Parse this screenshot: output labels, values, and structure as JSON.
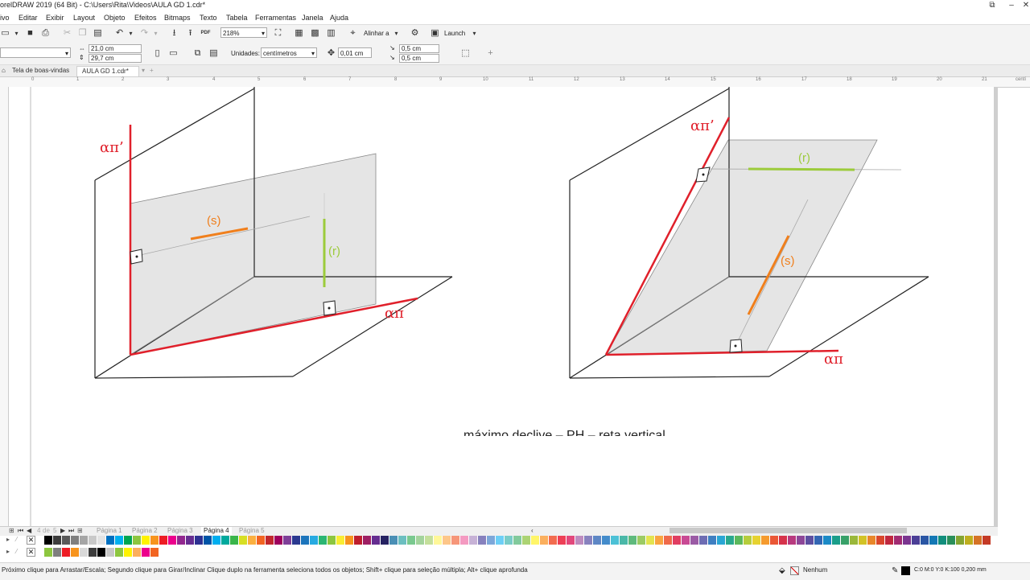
{
  "titlebar": {
    "title": "orelDRAW 2019 (64 Bit) - C:\\Users\\Rita\\Videos\\AULA GD 1.cdr*"
  },
  "menu": [
    "ivo",
    "Editar",
    "Exibir",
    "Layout",
    "Objeto",
    "Efeitos",
    "Bitmaps",
    "Texto",
    "Tabela",
    "Ferramentas",
    "Janela",
    "Ajuda"
  ],
  "toolbar": {
    "zoom": "218%",
    "align_label": "Alinhar a",
    "launch_label": "Launch",
    "pdf_label": "PDF"
  },
  "propbar": {
    "width": "21,0 cm",
    "height": "29,7 cm",
    "units_label": "Unidades:",
    "units_value": "centímetros",
    "nudge": "0,01 cm",
    "dup_x": "0,5 cm",
    "dup_y": "0,5 cm"
  },
  "tabs": {
    "welcome": "Tela de boas-vindas",
    "document": "AULA GD 1.cdr*"
  },
  "ruler": {
    "numbers": [
      "0",
      "1",
      "2",
      "3",
      "4",
      "5",
      "6",
      "7",
      "8",
      "9",
      "10",
      "11",
      "12",
      "13",
      "14",
      "15",
      "16",
      "17",
      "18",
      "19",
      "20",
      "21"
    ],
    "unit": "centí"
  },
  "canvas": {
    "left_figure": {
      "label_vertical_trace": "απ’",
      "label_horizontal_trace": "απ",
      "line_s": "(s)",
      "line_r": "(r)"
    },
    "right_figure": {
      "label_vertical_trace": "απ’",
      "label_horizontal_trace": "απ",
      "line_s": "(s)",
      "line_r": "(r)"
    },
    "caption": "máximo declive – PH – reta vertical"
  },
  "pages": {
    "counter_current": "4",
    "counter_sep": "de",
    "counter_total": "5",
    "tabs": [
      "Página 1",
      "Página 2",
      "Página 3",
      "Página 4",
      "Página 5"
    ],
    "active_index": 3
  },
  "palette": {
    "row1": [
      "#ffffff",
      "#000000",
      "#3d3d3d",
      "#595959",
      "#7f7f7f",
      "#a5a5a5",
      "#c9c9c9",
      "#e3e3e3",
      "#0070c0",
      "#00b0f0",
      "#00a651",
      "#8dc63f",
      "#fff200",
      "#f7941d",
      "#ed1c24",
      "#ec008c",
      "#92278f",
      "#662d91",
      "#2e3192",
      "#0054a6",
      "#00aeef",
      "#00a99d",
      "#39b54a",
      "#d7df23",
      "#fbb040",
      "#f26522",
      "#c1272d",
      "#9e005d",
      "#7f3f98",
      "#2b3990",
      "#1c75bc",
      "#27aae1",
      "#2bb673",
      "#8cc63f",
      "#f9ed32",
      "#f7941d",
      "#be1e2d",
      "#9e1f63",
      "#652d90",
      "#262262",
      "#4a8fb5",
      "#6cbfc0",
      "#7ac98f",
      "#a3d39c",
      "#c4df9b",
      "#fff799",
      "#fdc689",
      "#f69679",
      "#f49ac1",
      "#c7b2d6",
      "#8781bd",
      "#7da7d9",
      "#6dcff6",
      "#7accc8",
      "#82ca9c",
      "#acd373",
      "#fff568",
      "#fbaf5d",
      "#f26c4f",
      "#ee4056",
      "#e2487c",
      "#bd8cbf",
      "#8882be",
      "#5e87c5",
      "#448ccb",
      "#4cc1d6",
      "#4ab8a8",
      "#5fba7d",
      "#9ccb64",
      "#e3e44f",
      "#f9a541",
      "#ef6a4a",
      "#e13e62",
      "#c94a94",
      "#9b5ba5",
      "#6e6db3",
      "#3f7fc1",
      "#2aa6d4",
      "#2aa88e",
      "#5cb85c",
      "#b6cd3c",
      "#e6d230",
      "#f59b2e",
      "#ea5735",
      "#d6334b",
      "#b83a7f",
      "#8d4798",
      "#5d4fa0",
      "#3366b3",
      "#1b8ac6",
      "#1a9e8a",
      "#38a169",
      "#9ab83a",
      "#d2c326",
      "#e8872a",
      "#d9472c",
      "#c0283f",
      "#a12c72",
      "#7b3590",
      "#4b3f96",
      "#2a56a4",
      "#1478b5",
      "#128e7c",
      "#2a8f5a",
      "#84a431",
      "#bfae1e",
      "#d57326",
      "#c43a26",
      "#a92236",
      "#8c2465",
      "#682d84",
      "#3d338a",
      "#214a95"
    ],
    "row2": [
      "#ffffff",
      "#8dc63f",
      "#7f7f7f",
      "#ed1c24",
      "#f7941d",
      "#d9d9d9",
      "#3d3d3d",
      "#000000",
      "#c8c8c8",
      "#8dc63f",
      "#fff200",
      "#fbaf5d",
      "#ec008c",
      "#f26522"
    ]
  },
  "status": {
    "message": "Próximo clique para Arrastar/Escala; Segundo clique para Girar/Inclinar Clique duplo na ferramenta seleciona todos os objetos; Shift+ clique para seleção múltipla; Alt+ clique aprofunda",
    "fill_label": "Nenhum",
    "outline_label": "C:0 M:0 Y:0 K:100  0,200 mm"
  }
}
